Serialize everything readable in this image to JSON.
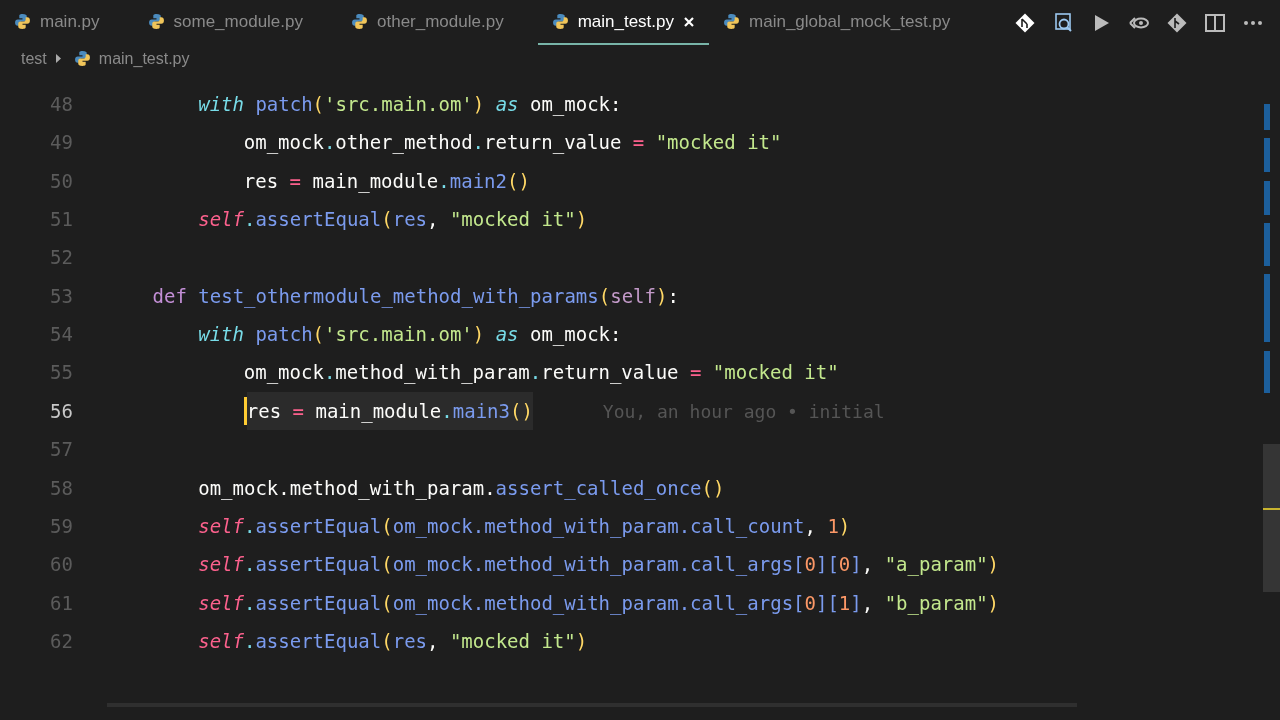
{
  "tabs": [
    {
      "label": "main.py",
      "selected": false
    },
    {
      "label": "some_module.py",
      "selected": false
    },
    {
      "label": "other_module.py",
      "selected": false
    },
    {
      "label": "main_test.py",
      "selected": true
    },
    {
      "label": "main_global_mock_test.py",
      "selected": false
    }
  ],
  "breadcrumb": {
    "folder": "test",
    "file": "main_test.py"
  },
  "lines": [
    {
      "number": "48",
      "current": false,
      "tokens": [
        {
          "kind": "kw",
          "text": "        with"
        },
        {
          "kind": "fn",
          "text": " patch"
        },
        {
          "kind": "p",
          "text": "("
        },
        {
          "kind": "str",
          "text": "'src.main.om'"
        },
        {
          "kind": "p",
          "text": ")"
        },
        {
          "kind": "kw",
          "text": " as"
        },
        {
          "kind": "plain",
          "text": " om_mock:"
        }
      ]
    },
    {
      "number": "49",
      "current": false,
      "tokens": [
        {
          "kind": "plain",
          "text": "            om_mock"
        },
        {
          "kind": "dot",
          "text": "."
        },
        {
          "kind": "plain",
          "text": "other_method"
        },
        {
          "kind": "dot",
          "text": "."
        },
        {
          "kind": "plain",
          "text": "return_value "
        },
        {
          "kind": "op",
          "text": "="
        },
        {
          "kind": "str",
          "text": " \"mocked it\""
        }
      ]
    },
    {
      "number": "50",
      "current": false,
      "tokens": [
        {
          "kind": "plain",
          "text": "            res "
        },
        {
          "kind": "op",
          "text": "="
        },
        {
          "kind": "plain",
          "text": " main_module"
        },
        {
          "kind": "dot",
          "text": "."
        },
        {
          "kind": "fn",
          "text": "main2"
        },
        {
          "kind": "p",
          "text": "()"
        }
      ]
    },
    {
      "number": "51",
      "current": false,
      "tokens": [
        {
          "kind": "self",
          "text": "        self"
        },
        {
          "kind": "dot",
          "text": "."
        },
        {
          "kind": "fn",
          "text": "assertEqual"
        },
        {
          "kind": "p",
          "text": "("
        },
        {
          "kind": "fn",
          "text": "res"
        },
        {
          "kind": "plain",
          "text": ", "
        },
        {
          "kind": "str",
          "text": "\"mocked it\""
        },
        {
          "kind": "p",
          "text": ")"
        }
      ]
    },
    {
      "number": "52",
      "current": false
    },
    {
      "number": "53",
      "current": false,
      "tokens": [
        {
          "kind": "def",
          "text": "    def"
        },
        {
          "kind": "fn",
          "text": " test_othermodule_method_with_params"
        },
        {
          "kind": "p",
          "text": "("
        },
        {
          "kind": "param",
          "text": "self"
        },
        {
          "kind": "p",
          "text": ")"
        },
        {
          "kind": "plain",
          "text": ":"
        }
      ]
    },
    {
      "number": "54",
      "current": false,
      "tokens": [
        {
          "kind": "kw",
          "text": "        with"
        },
        {
          "kind": "fn",
          "text": " patch"
        },
        {
          "kind": "p",
          "text": "("
        },
        {
          "kind": "str",
          "text": "'src.main.om'"
        },
        {
          "kind": "p",
          "text": ")"
        },
        {
          "kind": "kw",
          "text": " as"
        },
        {
          "kind": "plain",
          "text": " om_mock:"
        }
      ]
    },
    {
      "number": "55",
      "current": false,
      "tokens": [
        {
          "kind": "plain",
          "text": "            om_mock"
        },
        {
          "kind": "dot",
          "text": "."
        },
        {
          "kind": "plain",
          "text": "method_with_param"
        },
        {
          "kind": "dot",
          "text": "."
        },
        {
          "kind": "plain",
          "text": "return_value "
        },
        {
          "kind": "op",
          "text": "="
        },
        {
          "kind": "str",
          "text": " \"mocked it\""
        }
      ]
    },
    {
      "number": "56",
      "current": true,
      "blame": "You, an hour ago • initial",
      "tokens": [
        {
          "kind": "plain",
          "text": "            res "
        },
        {
          "kind": "op",
          "text": "="
        },
        {
          "kind": "plain",
          "text": " main_module"
        },
        {
          "kind": "dot",
          "text": "."
        },
        {
          "kind": "fn",
          "text": "main3"
        },
        {
          "kind": "p",
          "text": "()"
        }
      ]
    },
    {
      "number": "57",
      "current": false
    },
    {
      "number": "58",
      "current": false,
      "tokens": [
        {
          "kind": "plain",
          "text": "        om_mock.method_with_param."
        },
        {
          "kind": "fn",
          "text": "assert_called_once"
        },
        {
          "kind": "p",
          "text": "()"
        }
      ]
    },
    {
      "number": "59",
      "current": false,
      "tokens": [
        {
          "kind": "self",
          "text": "        self"
        },
        {
          "kind": "dot",
          "text": "."
        },
        {
          "kind": "fn",
          "text": "assertEqual"
        },
        {
          "kind": "p",
          "text": "("
        },
        {
          "kind": "fn",
          "text": "om_mock.method_with_param.call_count"
        },
        {
          "kind": "plain",
          "text": ", "
        },
        {
          "kind": "num",
          "text": "1"
        },
        {
          "kind": "p",
          "text": ")"
        }
      ]
    },
    {
      "number": "60",
      "current": false,
      "tokens": [
        {
          "kind": "self",
          "text": "        self"
        },
        {
          "kind": "dot",
          "text": "."
        },
        {
          "kind": "fn",
          "text": "assertEqual"
        },
        {
          "kind": "p",
          "text": "("
        },
        {
          "kind": "fn",
          "text": "om_mock.method_with_param.call_args["
        },
        {
          "kind": "num",
          "text": "0"
        },
        {
          "kind": "fn",
          "text": "]["
        },
        {
          "kind": "num",
          "text": "0"
        },
        {
          "kind": "fn",
          "text": "]"
        },
        {
          "kind": "plain",
          "text": ", "
        },
        {
          "kind": "str",
          "text": "\"a_param\""
        },
        {
          "kind": "p",
          "text": ")"
        }
      ]
    },
    {
      "number": "61",
      "current": false,
      "tokens": [
        {
          "kind": "self",
          "text": "        self"
        },
        {
          "kind": "dot",
          "text": "."
        },
        {
          "kind": "fn",
          "text": "assertEqual"
        },
        {
          "kind": "p",
          "text": "("
        },
        {
          "kind": "fn",
          "text": "om_mock.method_with_param.call_args["
        },
        {
          "kind": "num",
          "text": "0"
        },
        {
          "kind": "fn",
          "text": "]["
        },
        {
          "kind": "num",
          "text": "1"
        },
        {
          "kind": "fn",
          "text": "]"
        },
        {
          "kind": "plain",
          "text": ", "
        },
        {
          "kind": "str",
          "text": "\"b_param\""
        },
        {
          "kind": "p",
          "text": ")"
        }
      ]
    },
    {
      "number": "62",
      "current": false,
      "tokens": [
        {
          "kind": "self",
          "text": "        self"
        },
        {
          "kind": "dot",
          "text": "."
        },
        {
          "kind": "fn",
          "text": "assertEqual"
        },
        {
          "kind": "p",
          "text": "("
        },
        {
          "kind": "fn",
          "text": "res"
        },
        {
          "kind": "plain",
          "text": ", "
        },
        {
          "kind": "str",
          "text": "\"mocked it\""
        },
        {
          "kind": "p",
          "text": ")"
        }
      ]
    }
  ]
}
